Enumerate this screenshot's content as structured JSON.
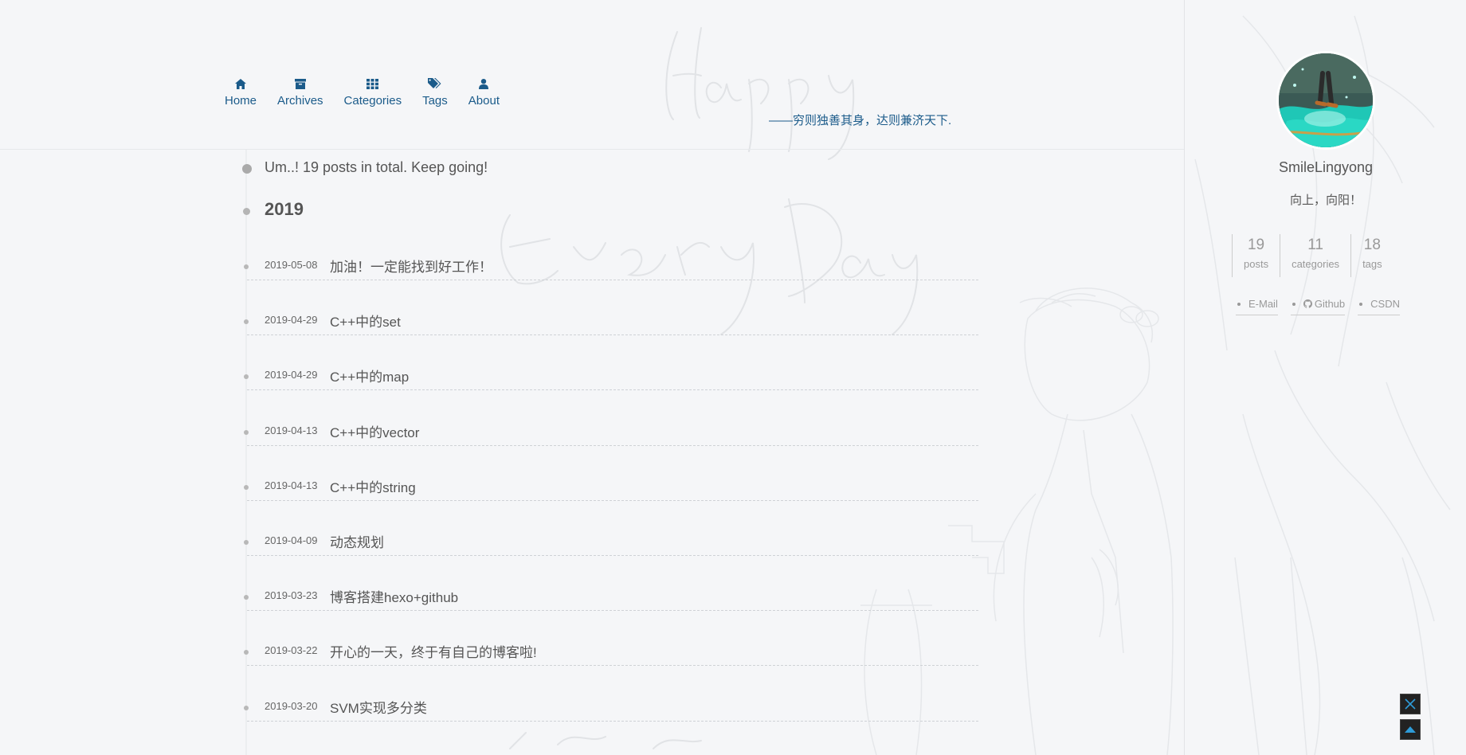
{
  "nav": {
    "items": [
      {
        "label": "Home",
        "icon": "home-icon"
      },
      {
        "label": "Archives",
        "icon": "archive-icon"
      },
      {
        "label": "Categories",
        "icon": "grid-icon"
      },
      {
        "label": "Tags",
        "icon": "tags-icon"
      },
      {
        "label": "About",
        "icon": "user-icon"
      }
    ],
    "motto": "——穷则独善其身，达则兼济天下."
  },
  "archive": {
    "total_text": "Um..! 19 posts in total. Keep going!",
    "year": "2019",
    "posts": [
      {
        "date": "2019-05-08",
        "title": "加油！一定能找到好工作！"
      },
      {
        "date": "2019-04-29",
        "title": "C++中的set"
      },
      {
        "date": "2019-04-29",
        "title": "C++中的map"
      },
      {
        "date": "2019-04-13",
        "title": "C++中的vector"
      },
      {
        "date": "2019-04-13",
        "title": "C++中的string"
      },
      {
        "date": "2019-04-09",
        "title": "动态规划"
      },
      {
        "date": "2019-03-23",
        "title": "博客搭建hexo+github"
      },
      {
        "date": "2019-03-22",
        "title": "开心的一天，终于有自己的博客啦!"
      },
      {
        "date": "2019-03-20",
        "title": "SVM实现多分类"
      }
    ]
  },
  "sidebar": {
    "author": "SmileLingyong",
    "bio": "向上，向阳！",
    "stats": [
      {
        "count": "19",
        "label": "posts"
      },
      {
        "count": "11",
        "label": "categories"
      },
      {
        "count": "18",
        "label": "tags"
      }
    ],
    "links": [
      {
        "label": "E-Mail",
        "icon": ""
      },
      {
        "label": "Github",
        "icon": "github-icon"
      },
      {
        "label": "CSDN",
        "icon": ""
      }
    ]
  },
  "colors": {
    "accent": "#1b5b8a",
    "background": "#f5f6f8",
    "float_button_bg": "#222222",
    "float_button_icon": "#2e9bd8"
  }
}
